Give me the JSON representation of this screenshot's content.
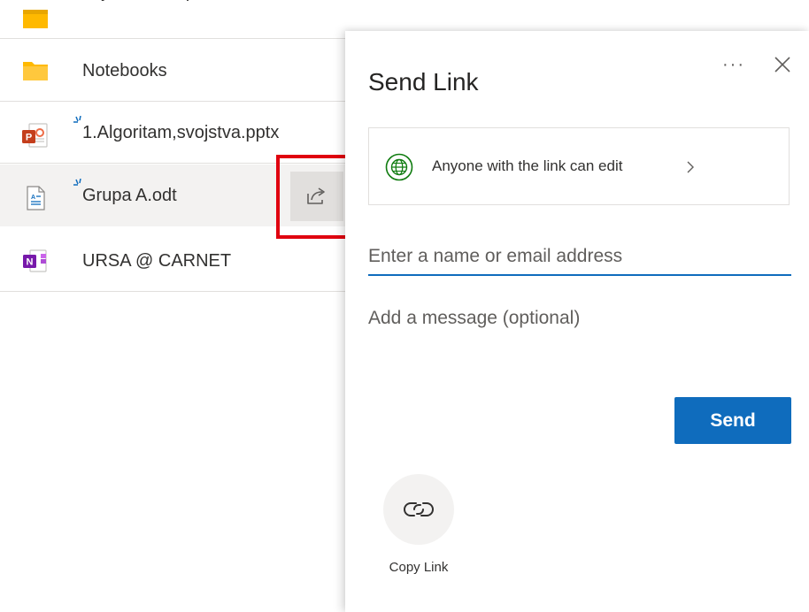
{
  "file_list": {
    "partial_row_label": "Biljeznice za predmete",
    "rows": [
      {
        "name": "Notebooks",
        "icon": "folder-icon"
      },
      {
        "name": "1.Algoritam,svojstva.pptx",
        "icon": "powerpoint-file-icon"
      },
      {
        "name": "Grupa A.odt",
        "icon": "odt-document-icon"
      },
      {
        "name": "URSA @ CARNET",
        "icon": "onenote-notebook-icon"
      }
    ],
    "share_icon": "share-icon"
  },
  "panel": {
    "title": "Send Link",
    "more_label": "···",
    "permission_text": "Anyone with the link can edit",
    "email_placeholder": "Enter a name or email address",
    "message_placeholder": "Add a message (optional)",
    "send_label": "Send",
    "copy_link_label": "Copy Link"
  },
  "colors": {
    "accent": "#0f6cbd",
    "highlight": "#e0000f",
    "globe_green": "#107c10",
    "folder": "#ffb900"
  }
}
